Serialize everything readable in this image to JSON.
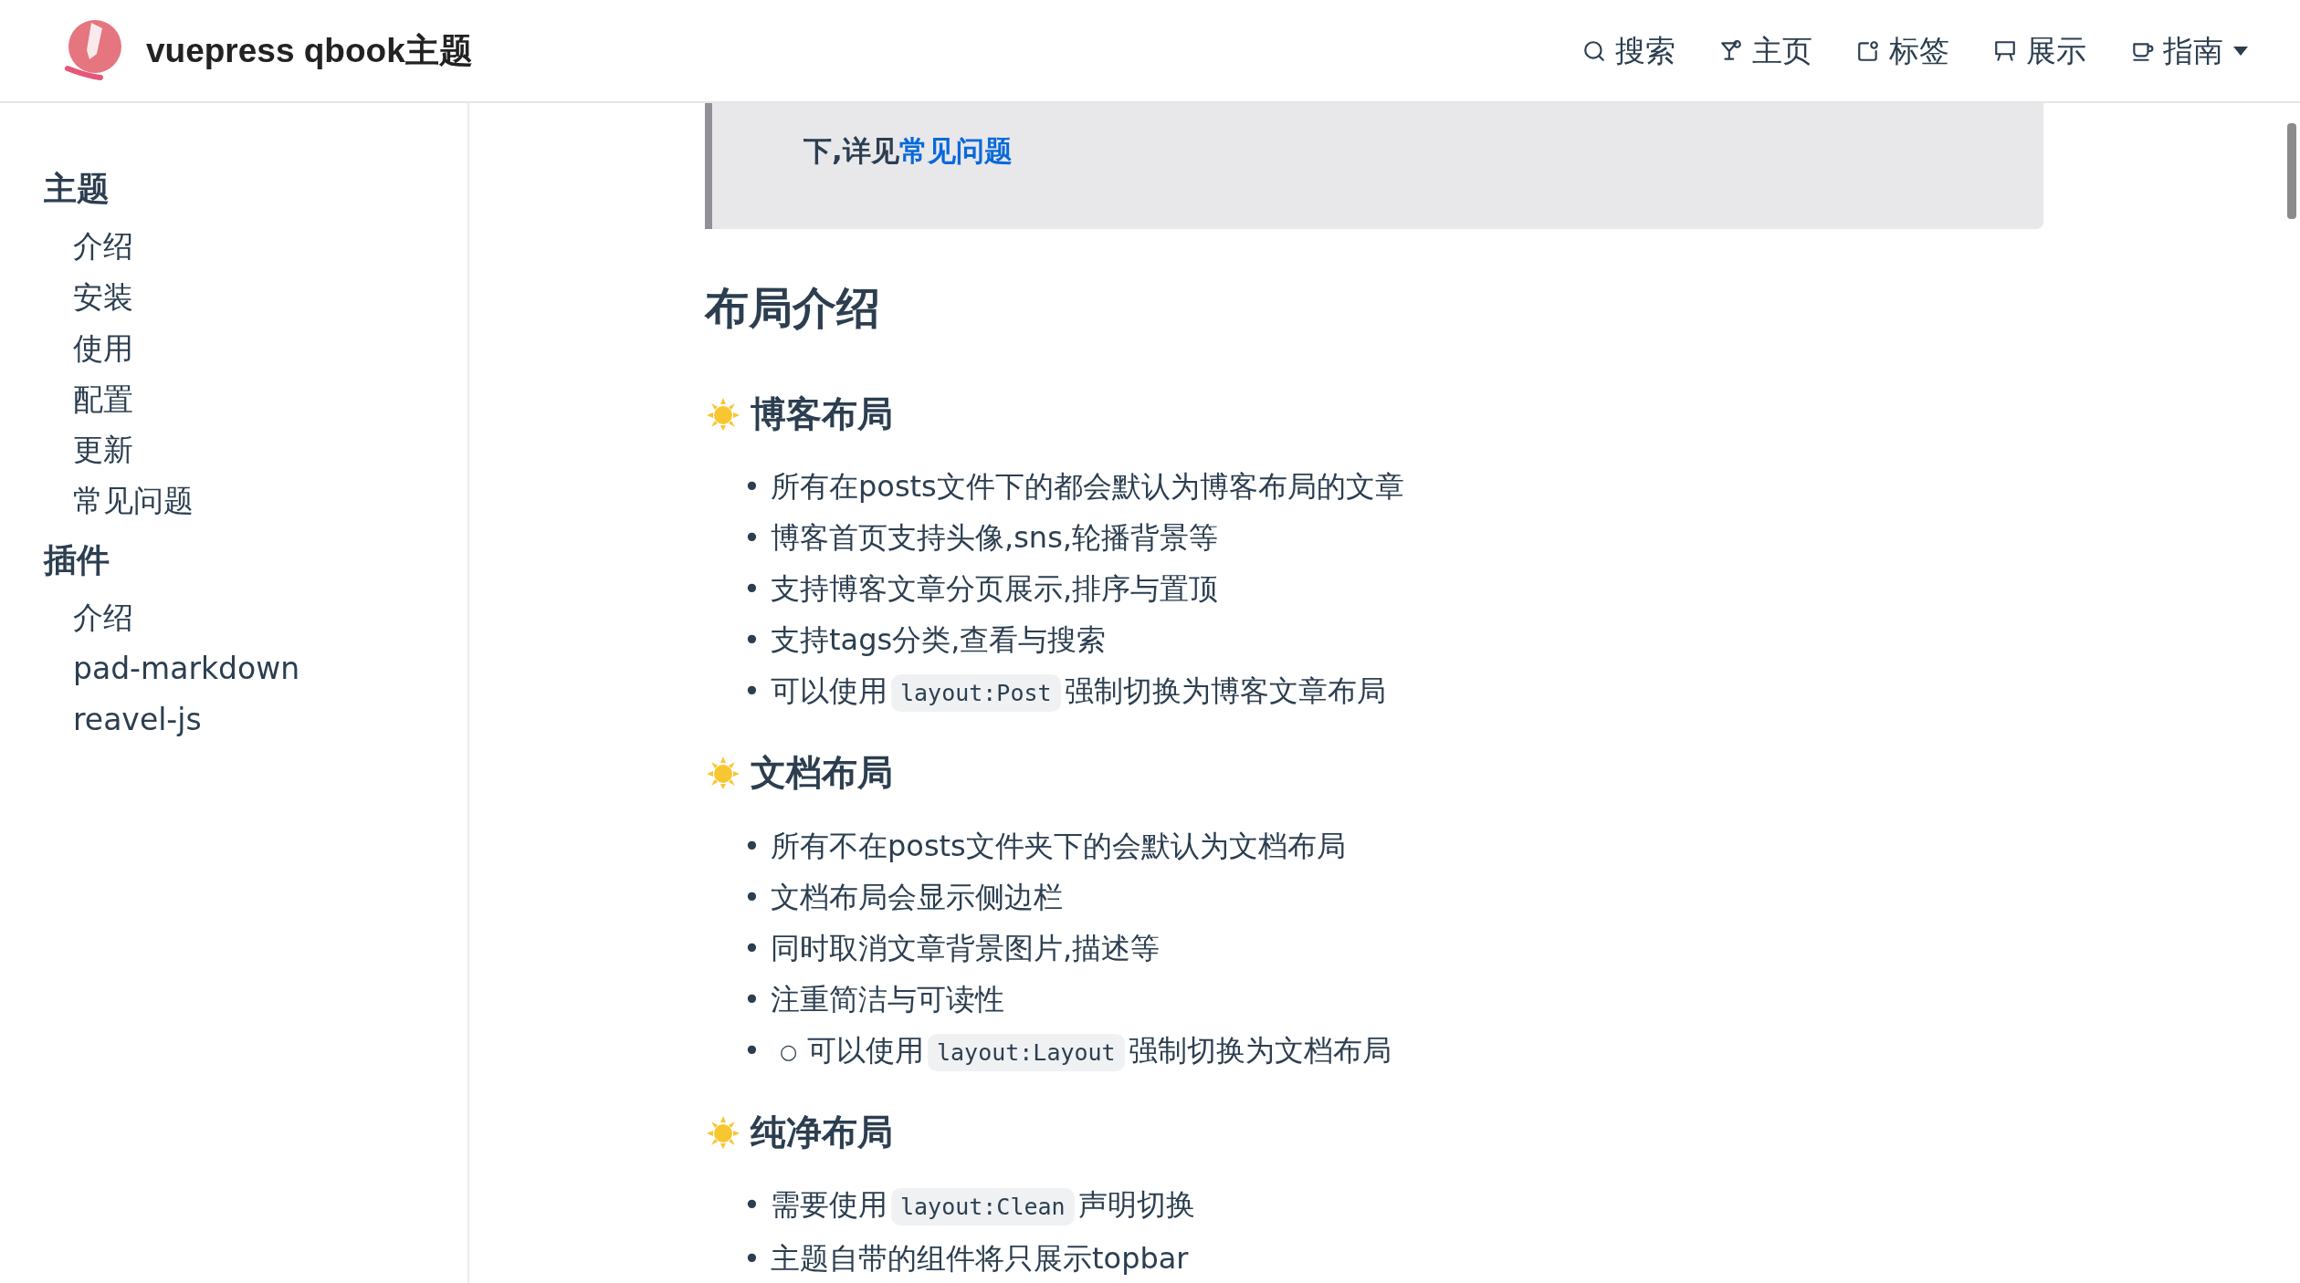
{
  "header": {
    "title": "vuepress qbook主题",
    "nav": [
      {
        "label": "搜索",
        "dropdown": false
      },
      {
        "label": "主页",
        "dropdown": false
      },
      {
        "label": "标签",
        "dropdown": false
      },
      {
        "label": "展示",
        "dropdown": false
      },
      {
        "label": "指南",
        "dropdown": true
      }
    ]
  },
  "sidebar": {
    "groups": [
      {
        "title": "主题",
        "items": [
          "介绍",
          "安装",
          "使用",
          "配置",
          "更新",
          "常见问题"
        ]
      },
      {
        "title": "插件",
        "items": [
          "介绍",
          "pad-markdown",
          "reavel-js"
        ]
      }
    ]
  },
  "callout": {
    "text": "下,详见",
    "link": "常见问题"
  },
  "heading": "布局介绍",
  "sections": [
    {
      "title": "博客布局",
      "items": [
        {
          "marker": "•",
          "parts": [
            {
              "kind": "text",
              "text": "所有在posts文件下的都会默认为博客布局的文章"
            }
          ]
        },
        {
          "marker": "•",
          "parts": [
            {
              "kind": "text",
              "text": "博客首页支持头像,sns,轮播背景等"
            }
          ]
        },
        {
          "marker": "•",
          "parts": [
            {
              "kind": "text",
              "text": "支持博客文章分页展示,排序与置顶"
            }
          ]
        },
        {
          "marker": "•",
          "parts": [
            {
              "kind": "text",
              "text": "支持tags分类,查看与搜索"
            }
          ]
        },
        {
          "marker": "•",
          "parts": [
            {
              "kind": "text",
              "text": "可以使用"
            },
            {
              "kind": "code",
              "text": "layout:Post"
            },
            {
              "kind": "text",
              "text": "强制切换为博客文章布局"
            }
          ]
        }
      ]
    },
    {
      "title": "文档布局",
      "items": [
        {
          "marker": "•",
          "parts": [
            {
              "kind": "text",
              "text": "所有不在posts文件夹下的会默认为文档布局"
            }
          ]
        },
        {
          "marker": "•",
          "parts": [
            {
              "kind": "text",
              "text": "文档布局会显示侧边栏"
            }
          ]
        },
        {
          "marker": "•",
          "parts": [
            {
              "kind": "text",
              "text": "同时取消文章背景图片,描述等"
            }
          ]
        },
        {
          "marker": "•",
          "parts": [
            {
              "kind": "text",
              "text": "注重简洁与可读性"
            }
          ]
        },
        {
          "marker": "•",
          "children": [
            {
              "marker": "○",
              "parts": [
                {
                  "kind": "text",
                  "text": "可以使用"
                },
                {
                  "kind": "code",
                  "text": "layout:Layout"
                },
                {
                  "kind": "text",
                  "text": "强制切换为文档布局"
                }
              ]
            }
          ]
        }
      ]
    },
    {
      "title": "纯净布局",
      "items": [
        {
          "marker": "•",
          "parts": [
            {
              "kind": "text",
              "text": "需要使用"
            },
            {
              "kind": "code",
              "text": "layout:Clean"
            },
            {
              "kind": "text",
              "text": "声明切换"
            }
          ]
        },
        {
          "marker": "•",
          "parts": [
            {
              "kind": "text",
              "text": "主题自带的组件将只展示topbar"
            }
          ]
        }
      ]
    }
  ]
}
